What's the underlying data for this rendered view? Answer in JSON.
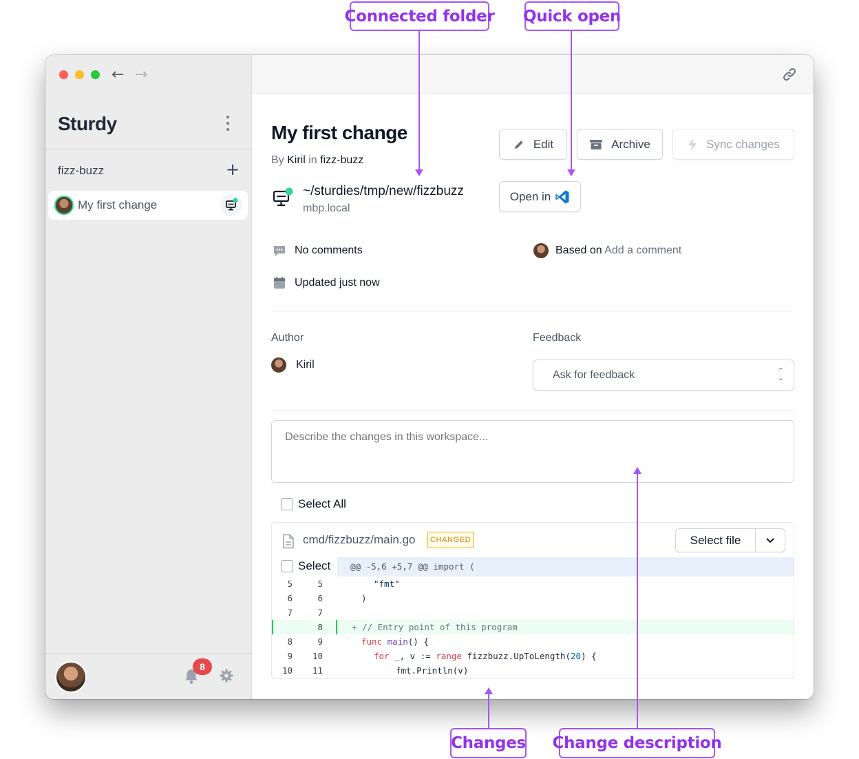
{
  "callouts": {
    "connected_folder": "Connected folder",
    "quick_open": "Quick open",
    "changes": "Changes",
    "change_description": "Change description"
  },
  "sidebar": {
    "brand": "Sturdy",
    "repo": "fizz-buzz",
    "workspace_item": "My first change",
    "notifications_count": "8"
  },
  "header": {
    "title": "My first change",
    "by_prefix": "By",
    "author": "Kiril",
    "in_word": "in",
    "repo": "fizz-buzz"
  },
  "actions": {
    "edit": "Edit",
    "archive": "Archive",
    "sync": "Sync changes",
    "open_in": "Open in"
  },
  "connected": {
    "path": "~/sturdies/tmp/new/fizzbuzz",
    "host": "mbp.local"
  },
  "meta": {
    "comments": "No comments",
    "updated": "Updated just now",
    "based_on_label": "Based on",
    "based_on_value": "Add a comment"
  },
  "people": {
    "author_label": "Author",
    "author_name": "Kiril",
    "feedback_label": "Feedback",
    "feedback_placeholder": "Ask for feedback"
  },
  "description": {
    "placeholder": "Describe the changes in this workspace..."
  },
  "diff": {
    "select_all": "Select All",
    "file": "cmd/fizzbuzz/main.go",
    "status": "CHANGED",
    "select_file": "Select file",
    "select": "Select",
    "hunk": "@@ -5,6 +5,7 @@ import (",
    "rows": [
      {
        "old": "5",
        "new": "5",
        "code": "\"fmt\""
      },
      {
        "old": "6",
        "new": "6",
        "code": ")"
      },
      {
        "old": "7",
        "new": "7",
        "code": ""
      },
      {
        "old": "",
        "new": "8",
        "code": "+ // Entry point of this program"
      },
      {
        "old": "8",
        "new": "9",
        "code": "func main() {"
      },
      {
        "old": "9",
        "new": "10",
        "code": "for _, v := range fizzbuzz.UpToLength(20) {"
      },
      {
        "old": "10",
        "new": "11",
        "code": "fmt.Println(v)"
      }
    ]
  },
  "colors": {
    "accent": "#a855f7",
    "online": "#34d399",
    "badge": "#e5484d",
    "changed": "#ca8a04"
  }
}
